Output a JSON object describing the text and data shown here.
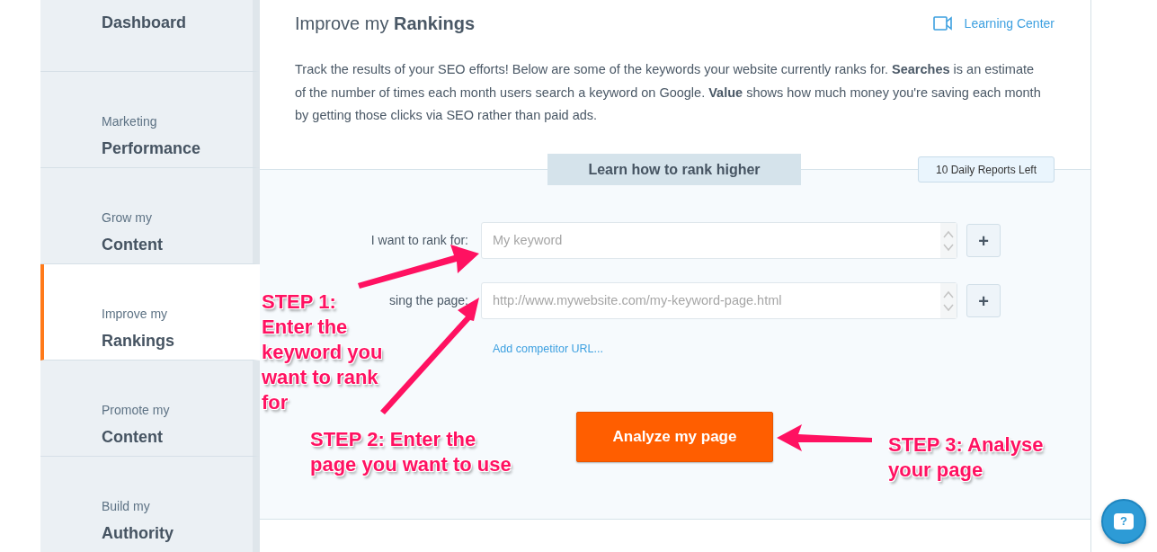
{
  "sidebar": {
    "items": [
      {
        "label": "Dashboard",
        "selected": false
      },
      {
        "small": "Marketing",
        "label": "Performance",
        "selected": false
      },
      {
        "small": "Grow my",
        "label": "Content",
        "selected": false
      },
      {
        "small": "Improve my",
        "label": "Rankings",
        "selected": true
      },
      {
        "small": "Promote my",
        "label": "Content",
        "selected": false
      },
      {
        "small": "Build my",
        "label": "Authority",
        "selected": false
      }
    ]
  },
  "header": {
    "title": "Improve my **Rankings**",
    "link": "Learning Center"
  },
  "intro": "Track the results of your SEO efforts! Below are some of the keywords your website currently ranks for. **Searches** is an estimate of the number of times each month users search a keyword on Google. **Value** shows how much money you're saving each month by getting those clicks via SEO rather than paid ads.",
  "section_tab": "Learn how to rank higher",
  "reports_left": "10 Daily Reports Left",
  "fields": [
    {
      "label": "I want to rank for:",
      "placeholder": "My keyword",
      "add_button": "+"
    },
    {
      "label": "sing the page:",
      "placeholder": "http://www.mywebsite.com/my-keyword-page.html",
      "add_button": "+"
    }
  ],
  "competitor_link": "Add competitor URL...",
  "analyze_button": "Analyze my page",
  "help_button": "?",
  "annotations": [
    {
      "text": "STEP 1: Enter the keyword you want to rank for"
    },
    {
      "text": "STEP 2: Enter the page you want to use"
    },
    {
      "text": "STEP 3: Analyse your page"
    }
  ]
}
